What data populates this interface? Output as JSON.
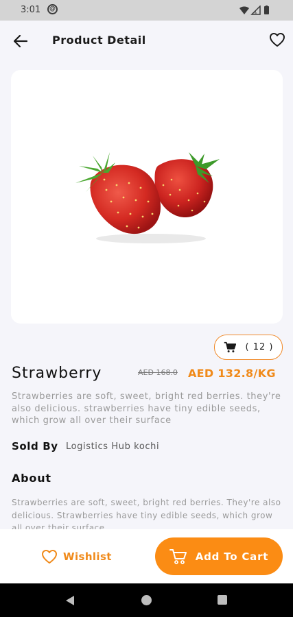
{
  "status_bar": {
    "time": "3:01",
    "at_symbol": "@"
  },
  "header": {
    "title": "Product Detail",
    "back_icon": "arrow-left-icon",
    "wishlist_icon": "heart-outline-icon"
  },
  "product": {
    "image_icon": "strawberry-image",
    "cart_count": "( 12 )",
    "name": "Strawberry",
    "old_price": "AED 168.0",
    "price": "AED 132.8/KG",
    "short_description": "Strawberries are soft, sweet, bright red berries. they're also delicious. strawberries have tiny edible seeds, which grow all over their surface",
    "sold_by_label": "Sold By",
    "sold_by_value": "Logistics Hub kochi",
    "about_title": "About",
    "about_text": "Strawberries are soft, sweet, bright red berries. They're also delicious. Strawberries have tiny edible seeds, which grow all over their surface"
  },
  "actions": {
    "wishlist_label": "Wishlist",
    "add_to_cart_label": "Add To Cart"
  },
  "colors": {
    "accent": "#fb8c14",
    "accent_text": "#f08a1a",
    "background": "#f5f5fa"
  }
}
